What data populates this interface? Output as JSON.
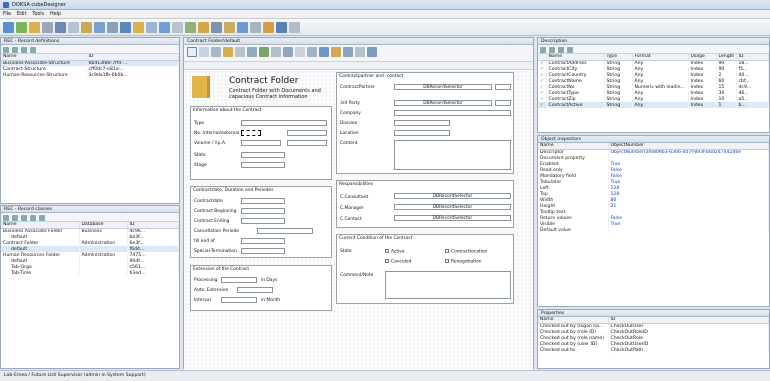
{
  "window": {
    "title": "DOKSA cubeDesigner"
  },
  "menu": [
    "File",
    "Edit",
    "Tools",
    "Help"
  ],
  "record_definitions": {
    "title": "REC - Record definitions",
    "columns": [
      "Name",
      "ID"
    ],
    "rows": [
      [
        "Business-Associate-Structure",
        "6bd13f80-7ff4-..."
      ],
      [
        "Contract-Structure",
        "cff0dc7-e81a-..."
      ],
      [
        "Human-Resources-Structure",
        "3c9da1fb-6b0b..."
      ]
    ]
  },
  "record_classes": {
    "title": "REC - Record classes",
    "columns": [
      "Name",
      "Database",
      "ID"
    ],
    "rows": [
      {
        "name": "Business Associate Folder",
        "db": "Business",
        "id": "4c96...",
        "indent": 0
      },
      {
        "name": "default",
        "db": "",
        "id": "ba3f...",
        "indent": 1
      },
      {
        "name": "Contract Folder",
        "db": "Administration",
        "id": "6e3f...",
        "indent": 0
      },
      {
        "name": "default",
        "db": "",
        "id": "f6d4...",
        "indent": 1
      },
      {
        "name": "Human Resources Folder",
        "db": "Administration",
        "id": "7475...",
        "indent": 0
      },
      {
        "name": "default",
        "db": "",
        "id": "90df...",
        "indent": 1
      },
      {
        "name": "Tab-Orga",
        "db": "",
        "id": "c561...",
        "indent": 1
      },
      {
        "name": "Tab-Time",
        "db": "",
        "id": "63ed...",
        "indent": 1
      }
    ]
  },
  "designer": {
    "title": "Contract Folder/default",
    "header": "Contract Folder",
    "subtitle": "Contract Folder with Documents and capacious Contract information",
    "info": {
      "title": "Information about the Contract",
      "type": "Type",
      "nr": "No. Internal/external",
      "volume": "Volume / Y.p.A.",
      "state": "State",
      "stage": "Stage"
    },
    "dates": {
      "title": "Contractdate, Duration and Periodes",
      "c1": "Contractdate",
      "c2": "Contract Beginning",
      "c3": "Contract Ending",
      "cp": "Cancellation Periode",
      "at": "till end of",
      "st": "Special-Termination"
    },
    "extension": {
      "title": "Extension of the Contract",
      "p": "Processing",
      "pu": "in Days",
      "a": "Auto. Extension",
      "i": "Interval",
      "iu": "in Month"
    },
    "partner": {
      "title": "Contractpartner and -contact",
      "cp": "ContractPartner",
      "tp": "3rd Party",
      "co": "Company",
      "dv": "Division",
      "lo": "Location",
      "ct": "Content",
      "sel1": "DBRecordSelector",
      "sel2": "DBRecordSelector"
    },
    "resp": {
      "title": "Responsibilities",
      "r1": "C.Consultant",
      "r2": "C.Manager",
      "r3": "C.Contact",
      "s1": "DBRecordSelector",
      "s2": "DBRecordSelector",
      "s3": "DBRecordSelector"
    },
    "cond": {
      "title": "Current Condition of the Contract",
      "state": "State",
      "a": "Active",
      "b": "Contractlocation",
      "c": "Canceled",
      "d": "Renegotiation",
      "cn": "Comment/Note"
    }
  },
  "description": {
    "title": "Description",
    "columns": [
      "Name",
      "Type",
      "Format",
      "Usage",
      "Length",
      "ID"
    ],
    "rows": [
      [
        "ContractAddress",
        "String",
        "Any",
        "Index",
        "90",
        "18..."
      ],
      [
        "ContractCity",
        "String",
        "Any",
        "Index",
        "90",
        "f5..."
      ],
      [
        "ContractCountry",
        "String",
        "Any",
        "Index",
        "2",
        "40..."
      ],
      [
        "ContractName",
        "String",
        "Any",
        "Index",
        "60",
        "cbf..."
      ],
      [
        "ContractNo",
        "String",
        "Numeric with leadin...",
        "Index",
        "15",
        "dc9..."
      ],
      [
        "ContractType",
        "String",
        "Any",
        "Index",
        "30",
        "d6..."
      ],
      [
        "ContractZip",
        "String",
        "Any",
        "Index",
        "10",
        "a5..."
      ],
      [
        "ContractActive",
        "String",
        "Any",
        "Index",
        "1",
        "b..."
      ]
    ]
  },
  "inspector": {
    "title": "Object inspectors",
    "columns": [
      "Name",
      "ObjectNumber"
    ],
    "rows": [
      [
        "Descriptor",
        "ObjectNumber(afe809b3-6366-407f-893f-b6d24744246e"
      ],
      [
        "Document property",
        ""
      ],
      [
        "Enabled",
        "True"
      ],
      [
        "Read only",
        "False"
      ],
      [
        "Mandatory field",
        "False"
      ],
      [
        "Tabulator",
        "True"
      ],
      [
        "Left",
        "128"
      ],
      [
        "Top",
        "128"
      ],
      [
        "Width",
        "80"
      ],
      [
        "Height",
        "21"
      ],
      [
        "Tooltip text",
        ""
      ],
      [
        "Return values",
        "False"
      ],
      [
        "Visible",
        "True"
      ],
      [
        "Default value",
        ""
      ]
    ]
  },
  "properties": {
    "title": "Properties",
    "columns": [
      "Name",
      "ID"
    ],
    "rows": [
      [
        "Checked out by (logon na...",
        "CheckOutUser"
      ],
      [
        "Checked out by (role ID)",
        "CheckOutRoleID"
      ],
      [
        "Checked out by (role name)",
        "CheckOutRole"
      ],
      [
        "Checked out by (user ID)",
        "CheckOutUserID"
      ],
      [
        "Checked out to",
        "CheckOutPath"
      ]
    ]
  },
  "status": "Lab-Emea / Future Ltd/ Supervisor (admin in System Support)",
  "colors": {
    "accent": "#3a6fb8",
    "folder": "#e0b54a"
  }
}
